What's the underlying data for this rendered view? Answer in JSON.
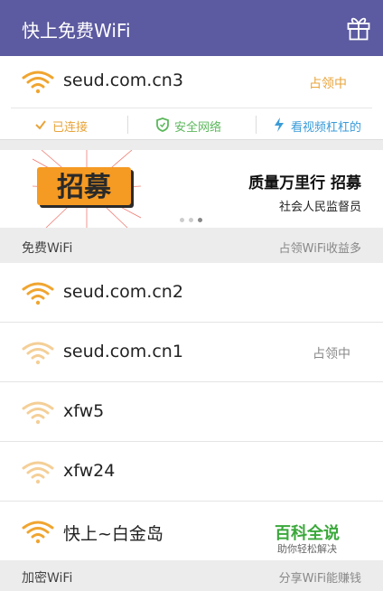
{
  "app": {
    "title": "快上免费WiFi"
  },
  "connected": {
    "ssid": "seud.com.cn3",
    "status": "占领中",
    "actions": [
      {
        "label": "已连接",
        "icon": "check-icon",
        "color": "#e8a43a"
      },
      {
        "label": "安全网络",
        "icon": "shield-icon",
        "color": "#5cb85c"
      },
      {
        "label": "看视频杠杠的",
        "icon": "lightning-icon",
        "color": "#3a9bd8"
      }
    ]
  },
  "banner": {
    "headline": "质量万里行 招募",
    "subline": "社会人民监督员",
    "image_text": "招募"
  },
  "free_section": {
    "title": "免费WiFi",
    "hint": "占领WiFi收益多"
  },
  "networks": [
    {
      "ssid": "seud.com.cn2",
      "tag": "",
      "signal": "strong"
    },
    {
      "ssid": "seud.com.cn1",
      "tag": "占领中",
      "signal": "weak"
    },
    {
      "ssid": "xfw5",
      "tag": "",
      "signal": "weak"
    },
    {
      "ssid": "xfw24",
      "tag": "",
      "signal": "weak"
    },
    {
      "ssid": "快上~白金岛",
      "tag": "",
      "signal": "strong"
    }
  ],
  "encrypted_section": {
    "title": "加密WiFi",
    "hint": "分享WiFi能赚钱"
  },
  "watermark": {
    "title": "百科全说",
    "subtitle": "助你轻松解决"
  },
  "colors": {
    "header": "#5c5aa0",
    "accent": "#e8a43a",
    "wifi_strong": "#f0a530",
    "wifi_weak": "#f4cf97"
  }
}
